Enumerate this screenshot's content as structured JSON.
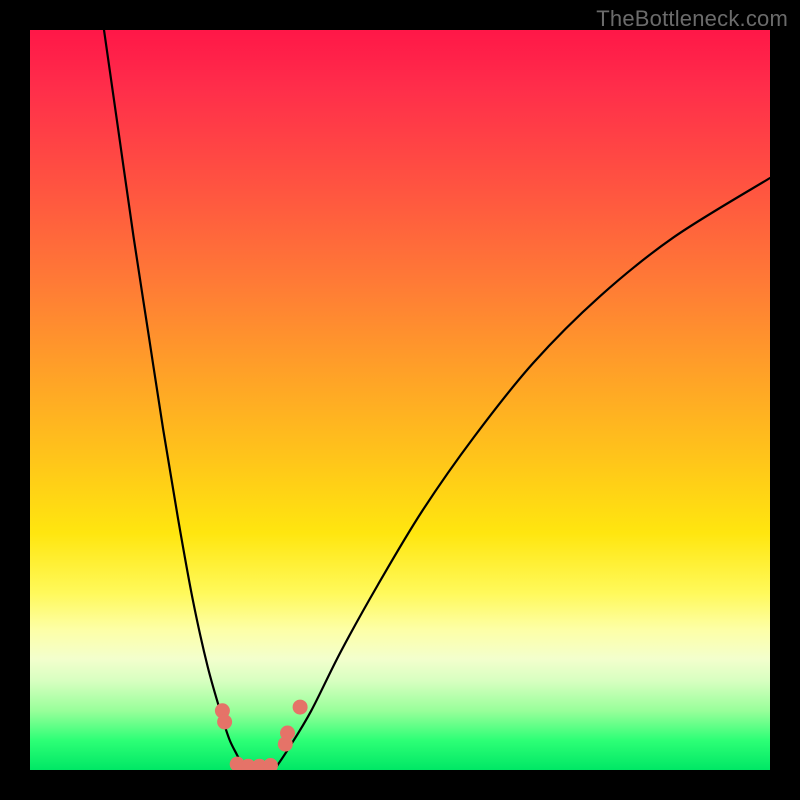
{
  "watermark": "TheBottleneck.com",
  "chart_data": {
    "type": "line",
    "title": "",
    "xlabel": "",
    "ylabel": "",
    "xlim": [
      0,
      100
    ],
    "ylim": [
      0,
      100
    ],
    "series": [
      {
        "name": "left-curve",
        "x": [
          10,
          12,
          14,
          16,
          18,
          20,
          22,
          24,
          26,
          27,
          28,
          29
        ],
        "y": [
          100,
          86,
          72,
          59,
          46,
          34,
          23,
          14,
          7,
          4,
          2,
          0
        ]
      },
      {
        "name": "right-curve",
        "x": [
          33,
          35,
          38,
          42,
          47,
          53,
          60,
          68,
          77,
          87,
          100
        ],
        "y": [
          0,
          3,
          8,
          16,
          25,
          35,
          45,
          55,
          64,
          72,
          80
        ]
      },
      {
        "name": "floor",
        "x": [
          29,
          33
        ],
        "y": [
          0,
          0
        ]
      }
    ],
    "markers": [
      {
        "x": 26.0,
        "y": 8.0
      },
      {
        "x": 26.3,
        "y": 6.5
      },
      {
        "x": 28.0,
        "y": 0.8
      },
      {
        "x": 29.5,
        "y": 0.5
      },
      {
        "x": 31.0,
        "y": 0.5
      },
      {
        "x": 32.5,
        "y": 0.6
      },
      {
        "x": 34.5,
        "y": 3.5
      },
      {
        "x": 34.8,
        "y": 5.0
      },
      {
        "x": 36.5,
        "y": 8.5
      }
    ],
    "marker_color": "#e57368",
    "curve_color": "#000000"
  }
}
